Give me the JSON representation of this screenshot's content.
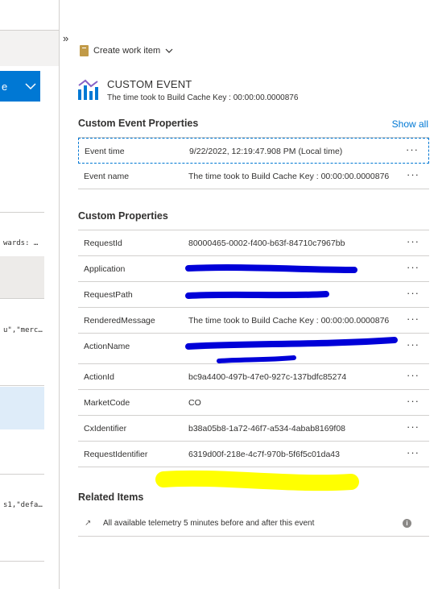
{
  "left_pane": {
    "dropdown_label": "e",
    "snippet_1": "wards: …",
    "snippet_2": "u\",\"merc…",
    "snippet_3": "s1,\"defa…"
  },
  "collapse_glyph": "»",
  "toolbar": {
    "create_work_item": "Create work item"
  },
  "event": {
    "type": "CUSTOM EVENT",
    "subtitle": "The time took to Build Cache Key : 00:00:00.0000876"
  },
  "custom_event_properties": {
    "title": "Custom Event Properties",
    "show_all": "Show all",
    "rows": [
      {
        "key": "Event time",
        "value": "9/22/2022, 12:19:47.908 PM (Local time)"
      },
      {
        "key": "Event name",
        "value": "The time took to Build Cache Key : 00:00:00.0000876"
      }
    ]
  },
  "custom_properties": {
    "title": "Custom Properties",
    "rows": [
      {
        "key": "RequestId",
        "value": "80000465-0002-f400-b63f-84710c7967bb"
      },
      {
        "key": "Application",
        "value": ""
      },
      {
        "key": "RequestPath",
        "value": ""
      },
      {
        "key": "RenderedMessage",
        "value": "The time took to Build Cache Key : 00:00:00.0000876"
      },
      {
        "key": "ActionName",
        "value": ""
      },
      {
        "key": "ActionId",
        "value": "bc9a4400-497b-47e0-927c-137bdfc85274"
      },
      {
        "key": "MarketCode",
        "value": "CO"
      },
      {
        "key": "CxIdentifier",
        "value": "b38a05b8-1a72-46f7-a534-4abab8169f08"
      },
      {
        "key": "RequestIdentifier",
        "value": "6319d00f-218e-4c7f-970b-5f6f5c01da43"
      }
    ]
  },
  "related_items": {
    "title": "Related Items",
    "item": "All available telemetry 5 minutes before and after this event"
  },
  "more_glyph": "···",
  "colors": {
    "accent": "#0078d4",
    "redaction_blue": "#0000d8",
    "redaction_yellow": "#ffff00"
  }
}
